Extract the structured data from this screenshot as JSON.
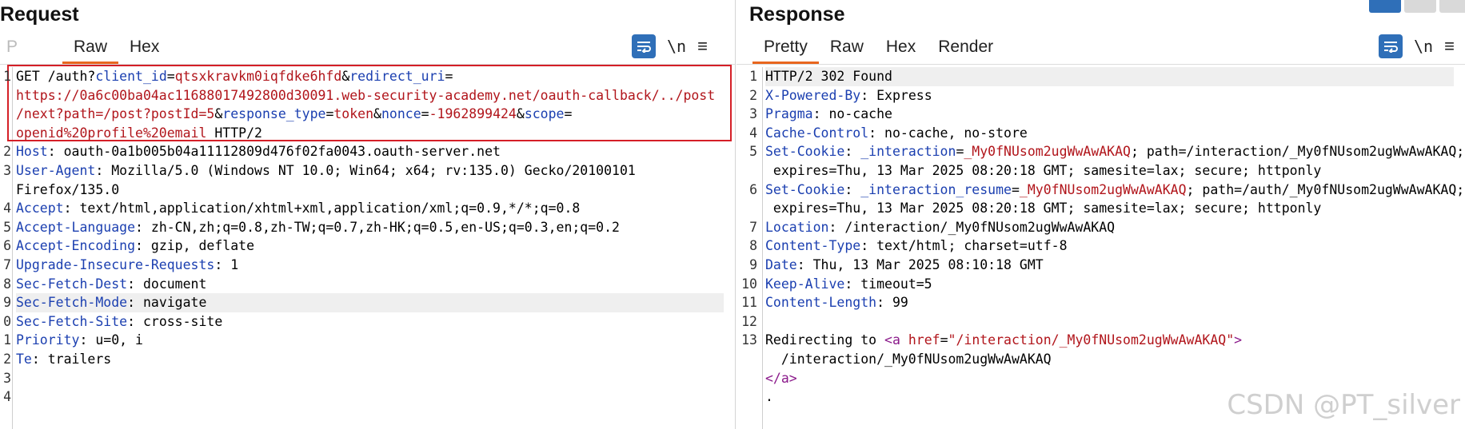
{
  "request": {
    "title": "Request",
    "tabs": {
      "faded": "P",
      "raw": "Raw",
      "hex": "Hex"
    },
    "tools": {
      "newline": "\\n",
      "menu": "≡"
    },
    "lines": [
      {
        "n": "1",
        "parts": [
          [
            "t",
            "GET /auth?"
          ],
          [
            "k",
            "client_id"
          ],
          [
            "t",
            "="
          ],
          [
            "v",
            "qtsxkravkm0iqfdke6hfd"
          ],
          [
            "t",
            "&"
          ],
          [
            "k",
            "redirect_uri"
          ],
          [
            "t",
            "="
          ]
        ]
      },
      {
        "n": "",
        "parts": [
          [
            "v",
            "https://0a6c00ba04ac11688017492800d30091.web-security-academy.net/oauth-callback/../post"
          ]
        ]
      },
      {
        "n": "",
        "parts": [
          [
            "v",
            "/next?path=/post?postId=5"
          ],
          [
            "t",
            "&"
          ],
          [
            "k",
            "response_type"
          ],
          [
            "t",
            "="
          ],
          [
            "v",
            "token"
          ],
          [
            "t",
            "&"
          ],
          [
            "k",
            "nonce"
          ],
          [
            "t",
            "="
          ],
          [
            "v",
            "-1962899424"
          ],
          [
            "t",
            "&"
          ],
          [
            "k",
            "scope"
          ],
          [
            "t",
            "="
          ]
        ]
      },
      {
        "n": "",
        "parts": [
          [
            "v",
            "openid%20profile%20email"
          ],
          [
            "t",
            " HTTP/2"
          ]
        ]
      },
      {
        "n": "2",
        "parts": [
          [
            "k",
            "Host"
          ],
          [
            "t",
            ": oauth-0a1b005b04a11112809d476f02fa0043.oauth-server.net"
          ]
        ]
      },
      {
        "n": "3",
        "parts": [
          [
            "k",
            "User-Agent"
          ],
          [
            "t",
            ": Mozilla/5.0 (Windows NT 10.0; Win64; x64; rv:135.0) Gecko/20100101"
          ]
        ]
      },
      {
        "n": "",
        "parts": [
          [
            "t",
            "Firefox/135.0"
          ]
        ]
      },
      {
        "n": "4",
        "parts": [
          [
            "k",
            "Accept"
          ],
          [
            "t",
            ": text/html,application/xhtml+xml,application/xml;q=0.9,*/*;q=0.8"
          ]
        ]
      },
      {
        "n": "5",
        "parts": [
          [
            "k",
            "Accept-Language"
          ],
          [
            "t",
            ": zh-CN,zh;q=0.8,zh-TW;q=0.7,zh-HK;q=0.5,en-US;q=0.3,en;q=0.2"
          ]
        ]
      },
      {
        "n": "6",
        "parts": [
          [
            "k",
            "Accept-Encoding"
          ],
          [
            "t",
            ": gzip, deflate"
          ]
        ]
      },
      {
        "n": "7",
        "parts": [
          [
            "k",
            "Upgrade-Insecure-Requests"
          ],
          [
            "t",
            ": 1"
          ]
        ]
      },
      {
        "n": "8",
        "parts": [
          [
            "k",
            "Sec-Fetch-Dest"
          ],
          [
            "t",
            ": document"
          ]
        ]
      },
      {
        "n": "9",
        "hl": true,
        "parts": [
          [
            "k",
            "Sec-Fetch-Mode"
          ],
          [
            "t",
            ": navigate"
          ]
        ]
      },
      {
        "n": "0",
        "parts": [
          [
            "k",
            "Sec-Fetch-Site"
          ],
          [
            "t",
            ": cross-site"
          ]
        ]
      },
      {
        "n": "1",
        "parts": [
          [
            "k",
            "Priority"
          ],
          [
            "t",
            ": u=0, i"
          ]
        ]
      },
      {
        "n": "2",
        "parts": [
          [
            "k",
            "Te"
          ],
          [
            "t",
            ": trailers"
          ]
        ]
      },
      {
        "n": "3",
        "parts": []
      },
      {
        "n": "4",
        "parts": []
      }
    ]
  },
  "response": {
    "title": "Response",
    "tabs": {
      "pretty": "Pretty",
      "raw": "Raw",
      "hex": "Hex",
      "render": "Render"
    },
    "tools": {
      "newline": "\\n",
      "menu": "≡"
    },
    "lines": [
      {
        "n": "1",
        "hl": true,
        "parts": [
          [
            "t",
            "HTTP/2 302 Found"
          ]
        ]
      },
      {
        "n": "2",
        "parts": [
          [
            "k",
            "X-Powered-By"
          ],
          [
            "t",
            ": Express"
          ]
        ]
      },
      {
        "n": "3",
        "parts": [
          [
            "k",
            "Pragma"
          ],
          [
            "t",
            ": no-cache"
          ]
        ]
      },
      {
        "n": "4",
        "parts": [
          [
            "k",
            "Cache-Control"
          ],
          [
            "t",
            ": no-cache, no-store"
          ]
        ]
      },
      {
        "n": "5",
        "parts": [
          [
            "k",
            "Set-Cookie"
          ],
          [
            "t",
            ": "
          ],
          [
            "k",
            "_interaction"
          ],
          [
            "t",
            "="
          ],
          [
            "v",
            "_My0fNUsom2ugWwAwAKAQ"
          ],
          [
            "t",
            "; path=/interaction/_My0fNUsom2ugWwAwAKAQ;"
          ]
        ]
      },
      {
        "n": "",
        "parts": [
          [
            "t",
            " expires=Thu, 13 Mar 2025 08:20:18 GMT; samesite=lax; secure; httponly"
          ]
        ]
      },
      {
        "n": "6",
        "parts": [
          [
            "k",
            "Set-Cookie"
          ],
          [
            "t",
            ": "
          ],
          [
            "k",
            "_interaction_resume"
          ],
          [
            "t",
            "="
          ],
          [
            "v",
            "_My0fNUsom2ugWwAwAKAQ"
          ],
          [
            "t",
            "; path=/auth/_My0fNUsom2ugWwAwAKAQ;"
          ]
        ]
      },
      {
        "n": "",
        "parts": [
          [
            "t",
            " expires=Thu, 13 Mar 2025 08:20:18 GMT; samesite=lax; secure; httponly"
          ]
        ]
      },
      {
        "n": "7",
        "parts": [
          [
            "k",
            "Location"
          ],
          [
            "t",
            ": /interaction/_My0fNUsom2ugWwAwAKAQ"
          ]
        ]
      },
      {
        "n": "8",
        "parts": [
          [
            "k",
            "Content-Type"
          ],
          [
            "t",
            ": text/html; charset=utf-8"
          ]
        ]
      },
      {
        "n": "9",
        "parts": [
          [
            "k",
            "Date"
          ],
          [
            "t",
            ": Thu, 13 Mar 2025 08:10:18 GMT"
          ]
        ]
      },
      {
        "n": "10",
        "parts": [
          [
            "k",
            "Keep-Alive"
          ],
          [
            "t",
            ": timeout=5"
          ]
        ]
      },
      {
        "n": "11",
        "parts": [
          [
            "k",
            "Content-Length"
          ],
          [
            "t",
            ": 99"
          ]
        ]
      },
      {
        "n": "12",
        "parts": []
      },
      {
        "n": "13",
        "parts": [
          [
            "t",
            "Redirecting to "
          ],
          [
            "tagc",
            "<a "
          ],
          [
            "attr",
            "href"
          ],
          [
            "t",
            "="
          ],
          [
            "v",
            "\"/interaction/_My0fNUsom2ugWwAwAKAQ\""
          ],
          [
            "tagc",
            ">"
          ]
        ]
      },
      {
        "n": "",
        "parts": [
          [
            "t",
            "  /interaction/_My0fNUsom2ugWwAwAKAQ"
          ]
        ]
      },
      {
        "n": "",
        "parts": [
          [
            "tagc",
            "</a>"
          ]
        ]
      },
      {
        "n": "",
        "parts": [
          [
            "t",
            "."
          ]
        ]
      }
    ]
  },
  "watermark": "CSDN @PT_silver",
  "colors": {
    "accent": "#e8661e",
    "blue_button": "#2f6fb8",
    "key": "#1b3fb0",
    "value": "#b1151b",
    "selection_border": "#d51f27"
  }
}
